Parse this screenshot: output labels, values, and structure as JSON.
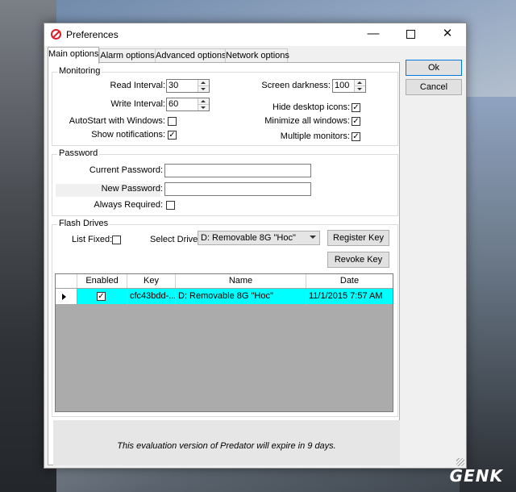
{
  "window": {
    "title": "Preferences",
    "minimize_glyph": "—",
    "close_glyph": "✕"
  },
  "tabs": [
    {
      "label": "Main options",
      "active": true
    },
    {
      "label": "Alarm options",
      "active": false
    },
    {
      "label": "Advanced options",
      "active": false
    },
    {
      "label": "Network options",
      "active": false
    }
  ],
  "monitoring": {
    "title": "Monitoring",
    "read_interval_label": "Read Interval:",
    "read_interval_value": "30",
    "write_interval_label": "Write Interval:",
    "write_interval_value": "60",
    "autostart_label": "AutoStart with Windows:",
    "autostart_checked": false,
    "show_notifications_label": "Show notifications:",
    "show_notifications_checked": true,
    "screen_darkness_label": "Screen darkness:",
    "screen_darkness_value": "100",
    "hide_desktop_icons_label": "Hide desktop icons:",
    "hide_desktop_icons_checked": true,
    "minimize_all_windows_label": "Minimize all windows:",
    "minimize_all_windows_checked": true,
    "multiple_monitors_label": "Multiple monitors:",
    "multiple_monitors_checked": true
  },
  "password": {
    "title": "Password",
    "current_label": "Current Password:",
    "current_value": "",
    "new_label": "New Password:",
    "new_value": "",
    "always_required_label": "Always Required:",
    "always_required_checked": false
  },
  "flash_drives": {
    "title": "Flash Drives",
    "list_fixed_label": "List Fixed:",
    "list_fixed_checked": false,
    "select_drive_label": "Select Drive:",
    "select_drive_value": "D: Removable 8G \"Hoc\"",
    "register_key_label": "Register Key",
    "revoke_key_label": "Revoke Key",
    "grid": {
      "columns": [
        "Enabled",
        "Key",
        "Name",
        "Date"
      ],
      "rows": [
        {
          "enabled": true,
          "key": "cfc43bdd-...",
          "name": "D: Removable 8G \"Hoc\"",
          "date": "11/1/2015 7:57 AM"
        }
      ],
      "selected_row_color": "#00ffff"
    }
  },
  "footer": {
    "message": "This evaluation version of Predator will expire in 9 days."
  },
  "buttons": {
    "ok_label": "Ok",
    "cancel_label": "Cancel"
  },
  "check_glyph": "✓",
  "watermark": "GENK"
}
